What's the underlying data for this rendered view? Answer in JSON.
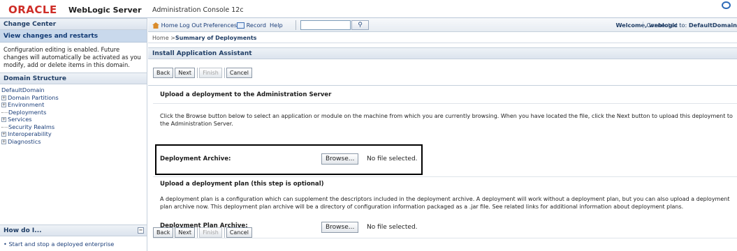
{
  "banner": {
    "oracle": "ORACLE",
    "product": "WebLogic Server",
    "subtitle": "Administration Console 12c"
  },
  "change_center": {
    "title": "Change Center",
    "view_link": "View changes and restarts",
    "message": "Configuration editing is enabled. Future changes will automatically be activated as you modify, add or delete items in this domain."
  },
  "domain_structure": {
    "title": "Domain Structure",
    "root": "DefaultDomain",
    "items": [
      {
        "label": "Domain Partitions",
        "toggle": "+"
      },
      {
        "label": "Environment",
        "toggle": "+"
      },
      {
        "label": "Deployments",
        "toggle": ""
      },
      {
        "label": "Services",
        "toggle": "+"
      },
      {
        "label": "Security Realms",
        "toggle": ""
      },
      {
        "label": "Interoperability",
        "toggle": "+"
      },
      {
        "label": "Diagnostics",
        "toggle": "+"
      }
    ]
  },
  "how_do_i": {
    "title": "How do I...",
    "collapse": "⊟",
    "items": [
      "Start and stop a deployed enterprise"
    ]
  },
  "toolbar": {
    "home": "Home",
    "logout": "Log Out",
    "preferences": "Preferences",
    "record": "Record",
    "help": "Help",
    "welcome": "Welcome, weblogic",
    "connected_prefix": "Connected to:",
    "connected_domain": "DefaultDomain"
  },
  "breadcrumb": {
    "home": "Home",
    "separator": " >",
    "current": "Summary of Deployments"
  },
  "assistant": {
    "title": "Install Application Assistant",
    "buttons": {
      "back": "Back",
      "next": "Next",
      "finish": "Finish",
      "cancel": "Cancel"
    },
    "upload_title": "Upload a deployment to the Administration Server",
    "upload_text": "Click the Browse button below to select an application or module on the machine from which you are currently browsing. When you have located the file, click the Next button to upload this deployment to the Administration Server.",
    "archive_label": "Deployment Archive:",
    "browse": "Browse...",
    "no_file": "No file selected.",
    "plan_title": "Upload a deployment plan (this step is optional)",
    "plan_text": "A deployment plan is a configuration which can supplement the descriptors included in the deployment archive. A deployment will work without a deployment plan, but you can also upload a deployment plan archive now. This deployment plan archive will be a directory of configuration information packaged as a .jar file. See related links for additional information about deployment plans.",
    "plan_label": "Deployment Plan Archive:"
  },
  "colors": {
    "oracle_red": "#ce2d27",
    "panel_header": "#203e66",
    "link_blue": "#1c3f7a",
    "highlight_border": "#000000"
  },
  "icons": [
    "home-icon",
    "record-icon",
    "search-icon",
    "collapse-icon",
    "help-circle-icon"
  ]
}
